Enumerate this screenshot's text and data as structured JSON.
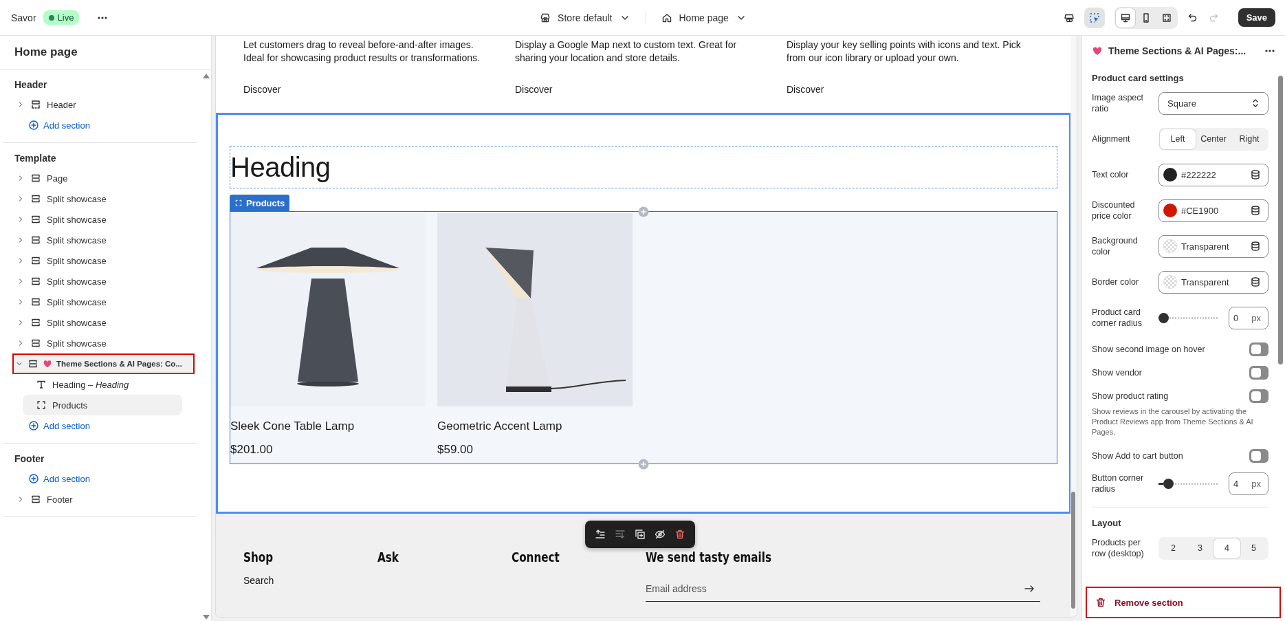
{
  "topbar": {
    "store": "Savor",
    "status": "Live",
    "theme": "Store default",
    "page": "Home page",
    "inspector_on": true,
    "device_views": [
      {
        "kind": "desktop",
        "selected": true
      },
      {
        "kind": "mobile",
        "selected": false
      },
      {
        "kind": "fullscreen",
        "selected": false
      }
    ],
    "history": [
      {
        "kind": "undo",
        "disabled": false
      },
      {
        "kind": "redo",
        "disabled": true
      }
    ],
    "save": "Save"
  },
  "sidebar": {
    "title": "Home page",
    "groups": [
      {
        "title": "Header",
        "items": [
          {
            "kind": "header",
            "label": "Header",
            "expanded": false,
            "selected": false
          },
          {
            "kind": "add",
            "label": "Add section"
          }
        ]
      },
      {
        "title": "Template",
        "items": [
          {
            "kind": "section",
            "label": "Page",
            "expanded": false,
            "selected": false
          },
          {
            "kind": "section",
            "label": "Split showcase",
            "expanded": false,
            "selected": false
          },
          {
            "kind": "section",
            "label": "Split showcase",
            "expanded": false,
            "selected": false
          },
          {
            "kind": "section",
            "label": "Split showcase",
            "expanded": false,
            "selected": false
          },
          {
            "kind": "section",
            "label": "Split showcase",
            "expanded": false,
            "selected": false
          },
          {
            "kind": "section",
            "label": "Split showcase",
            "expanded": false,
            "selected": false
          },
          {
            "kind": "section",
            "label": "Split showcase",
            "expanded": false,
            "selected": false
          },
          {
            "kind": "section",
            "label": "Split showcase",
            "expanded": false,
            "selected": false
          },
          {
            "kind": "section",
            "label": "Split showcase",
            "expanded": false,
            "selected": false
          },
          {
            "kind": "app_section",
            "label": "Theme Sections & AI Pages: Co...",
            "expanded": true,
            "selected": true,
            "children": [
              {
                "kind": "text",
                "label": "Heading – *Heading*",
                "selected": false
              },
              {
                "kind": "group",
                "label": "Products",
                "selected": true
              }
            ]
          },
          {
            "kind": "add",
            "label": "Add section"
          }
        ]
      },
      {
        "title": "Footer",
        "items": [
          {
            "kind": "add",
            "label": "Add section"
          },
          {
            "kind": "section",
            "label": "Footer",
            "expanded": false,
            "selected": false
          }
        ]
      }
    ]
  },
  "preview": {
    "features": [
      {
        "text": "Let customers drag to reveal before-and-after images. Ideal for showcasing product results or transformations.",
        "link": "Discover"
      },
      {
        "text": "Display a Google Map next to custom text. Great for sharing your location and store details.",
        "link": "Discover"
      },
      {
        "text": "Display your key selling points with icons and text. Pick from our icon library or upload your own.",
        "link": "Discover"
      }
    ],
    "heading": "Heading",
    "block_tag": "Products",
    "products": [
      {
        "name": "Sleek Cone Table Lamp",
        "price": "$201.00",
        "kind": "cone"
      },
      {
        "name": "Geometric Accent Lamp",
        "price": "$59.00",
        "kind": "geometric"
      }
    ],
    "toolbar": [
      {
        "kind": "move-up",
        "disabled": false
      },
      {
        "kind": "move-down",
        "disabled": true
      },
      {
        "kind": "duplicate",
        "disabled": false
      },
      {
        "kind": "hide",
        "disabled": false
      },
      {
        "kind": "delete",
        "disabled": false
      }
    ],
    "footer": {
      "columns": [
        {
          "title": "Shop",
          "links": [
            "Search"
          ]
        },
        {
          "title": "Ask"
        },
        {
          "title": "Connect"
        }
      ],
      "newsletter": "We send tasty emails",
      "email_placeholder": "Email address"
    }
  },
  "settings": {
    "title": "Theme Sections & AI Pages:...",
    "fields": [
      {
        "kind": "heading",
        "label": "Product card settings"
      },
      {
        "kind": "select",
        "label": "Image aspect ratio",
        "value": "Square"
      },
      {
        "kind": "segmented",
        "label": "Alignment",
        "options": [
          {
            "label": "Left",
            "selected": true
          },
          {
            "label": "Center",
            "selected": false
          },
          {
            "label": "Right",
            "selected": false
          }
        ]
      },
      {
        "kind": "color",
        "label": "Text color",
        "value": "#222222",
        "color": "#222222"
      },
      {
        "kind": "color",
        "label": "Discounted price color",
        "value": "#CE1900",
        "color": "#ce1900"
      },
      {
        "kind": "color",
        "label": "Background color",
        "value": "Transparent"
      },
      {
        "kind": "color",
        "label": "Border color",
        "value": "Transparent"
      },
      {
        "kind": "range",
        "label": "Product card corner radius",
        "level": 0,
        "value": "0",
        "unit": "px"
      },
      {
        "kind": "toggle",
        "label": "Show second image on hover",
        "on": false
      },
      {
        "kind": "toggle",
        "label": "Show vendor",
        "on": false
      },
      {
        "kind": "toggle",
        "label": "Show product rating",
        "on": false
      },
      {
        "kind": "note",
        "text": "Show reviews in the carousel by activating the Product Reviews app from Theme Sections & AI Pages."
      },
      {
        "kind": "toggle",
        "label": "Show Add to cart button",
        "on": false
      },
      {
        "kind": "range",
        "label": "Button corner radius",
        "level": 0.1,
        "value": "4",
        "unit": "px"
      },
      {
        "kind": "divider"
      },
      {
        "kind": "heading",
        "label": "Layout"
      },
      {
        "kind": "segmented",
        "label": "Products per row (desktop)",
        "options": [
          {
            "label": "2",
            "selected": false
          },
          {
            "label": "3",
            "selected": false
          },
          {
            "label": "4",
            "selected": true
          },
          {
            "label": "5",
            "selected": false
          }
        ]
      }
    ],
    "remove": "Remove section"
  }
}
